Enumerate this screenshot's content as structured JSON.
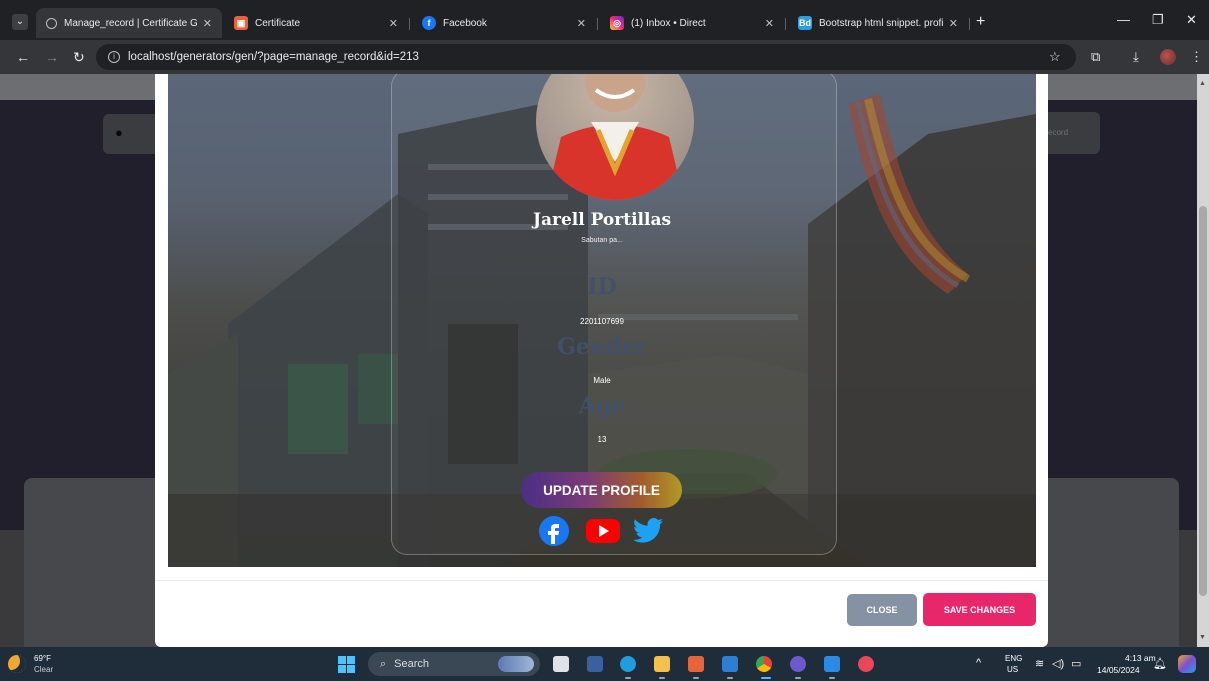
{
  "browser": {
    "tabs": [
      {
        "title": "Manage_record | Certificate Ge",
        "active": true,
        "favicon": "globe-icon"
      },
      {
        "title": "Certificate",
        "active": false,
        "favicon": "certificate-app-icon"
      },
      {
        "title": "Facebook",
        "active": false,
        "favicon": "facebook-icon"
      },
      {
        "title": "(1) Inbox • Direct",
        "active": false,
        "favicon": "instagram-icon"
      },
      {
        "title": "Bootstrap html snippet. profile",
        "active": false,
        "favicon": "bootdey-icon"
      }
    ],
    "url": "localhost/generators/gen/?page=manage_record&id=213"
  },
  "background_page": {
    "record_label": "ecord"
  },
  "profile": {
    "name": "Jarell Portillas",
    "bio": "Sabutan pa...",
    "fields": [
      {
        "label": "ID",
        "value": "2201107699"
      },
      {
        "label": "Gender",
        "value": "Male"
      },
      {
        "label": "Age",
        "value": "13"
      }
    ],
    "update_button": "UPDATE PROFILE",
    "social": [
      "facebook-icon",
      "youtube-icon",
      "twitter-icon"
    ]
  },
  "modal": {
    "close_label": "CLOSE",
    "save_label": "SAVE CHANGES"
  },
  "taskbar": {
    "weather_temp": "69°F",
    "weather_condition": "Clear",
    "search_placeholder": "Search",
    "language": "ENG",
    "region": "US",
    "time": "4:13 am",
    "date": "14/05/2024"
  },
  "colors": {
    "save_button": "#e8276b",
    "close_button": "#8592a3",
    "update_gradient_start": "#4a2f86",
    "update_gradient_end": "#b09a26"
  }
}
